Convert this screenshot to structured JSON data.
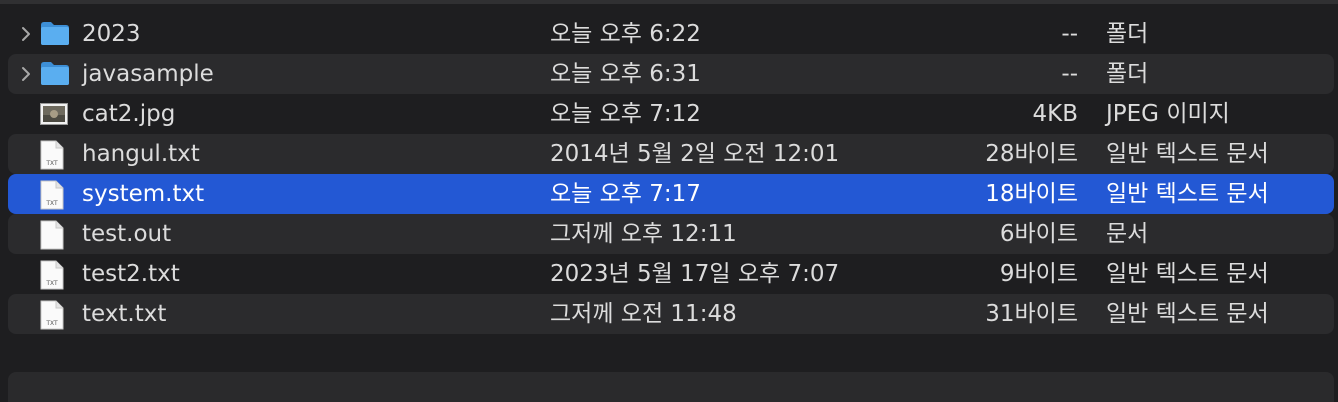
{
  "files": [
    {
      "name": "2023",
      "date": "오늘 오후 6:22",
      "size": "--",
      "kind": "폴더",
      "icon": "folder-icon",
      "expandable": true,
      "selected": false
    },
    {
      "name": "javasample",
      "date": "오늘 오후 6:31",
      "size": "--",
      "kind": "폴더",
      "icon": "folder-icon",
      "expandable": true,
      "selected": false
    },
    {
      "name": "cat2.jpg",
      "date": "오늘 오후 7:12",
      "size": "4KB",
      "kind": "JPEG 이미지",
      "icon": "image-thumbnail-icon",
      "expandable": false,
      "selected": false
    },
    {
      "name": "hangul.txt",
      "date": "2014년 5월 2일 오전 12:01",
      "size": "28바이트",
      "kind": "일반 텍스트 문서",
      "icon": "txt-document-icon",
      "expandable": false,
      "selected": false
    },
    {
      "name": "system.txt",
      "date": "오늘 오후 7:17",
      "size": "18바이트",
      "kind": "일반 텍스트 문서",
      "icon": "txt-document-icon",
      "expandable": false,
      "selected": true
    },
    {
      "name": "test.out",
      "date": "그저께 오후 12:11",
      "size": "6바이트",
      "kind": "문서",
      "icon": "blank-document-icon",
      "expandable": false,
      "selected": false
    },
    {
      "name": "test2.txt",
      "date": "2023년 5월 17일 오후 7:07",
      "size": "9바이트",
      "kind": "일반 텍스트 문서",
      "icon": "txt-document-icon",
      "expandable": false,
      "selected": false
    },
    {
      "name": "text.txt",
      "date": "그저께 오전 11:48",
      "size": "31바이트",
      "kind": "일반 텍스트 문서",
      "icon": "txt-document-icon",
      "expandable": false,
      "selected": false
    }
  ],
  "txt_icon_label": "TXT",
  "colors": {
    "background": "#1e1e20",
    "alternate_row": "#2b2b2d",
    "selection": "#2358d4",
    "folder": "#5aaef0",
    "text": "#dcdcdc"
  }
}
